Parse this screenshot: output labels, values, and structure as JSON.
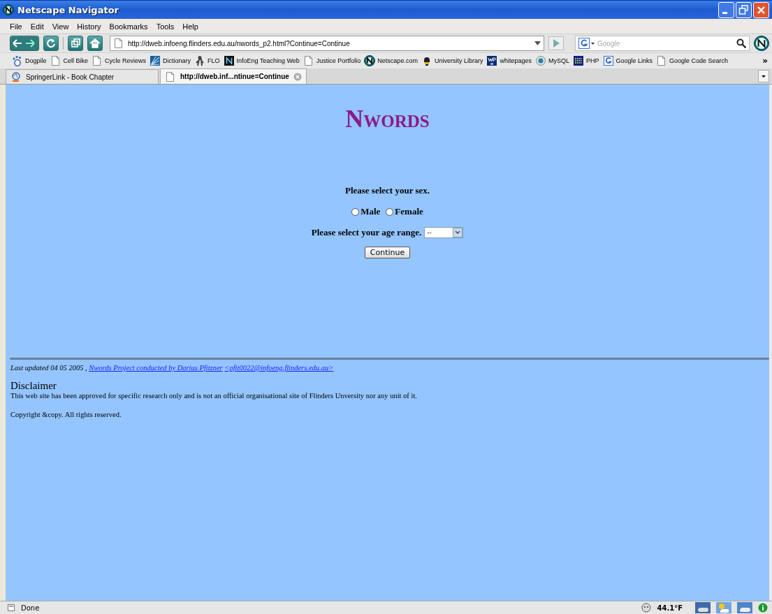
{
  "window": {
    "title": "Netscape Navigator"
  },
  "menu": [
    "File",
    "Edit",
    "View",
    "History",
    "Bookmarks",
    "Tools",
    "Help"
  ],
  "address": {
    "value": "http://dweb.infoeng.flinders.edu.au/nwords_p2.html?Continue=Continue"
  },
  "search": {
    "placeholder": "Google"
  },
  "bookmarks": [
    {
      "label": "Dogpile"
    },
    {
      "label": "Cell Bike"
    },
    {
      "label": "Cycle Reviews"
    },
    {
      "label": "Dictionary"
    },
    {
      "label": "FLO"
    },
    {
      "label": "InfoEng Teaching Web"
    },
    {
      "label": "Justice Portfolio"
    },
    {
      "label": "Netscape.com"
    },
    {
      "label": "University Library"
    },
    {
      "label": "whitepages"
    },
    {
      "label": "MySQL"
    },
    {
      "label": "PHP"
    },
    {
      "label": "Google Links"
    },
    {
      "label": "Google Code Search"
    }
  ],
  "bookmarks_more": "»",
  "tabs": [
    {
      "label": "SpringerLink - Book Chapter",
      "selected": false
    },
    {
      "label": "http://dweb.inf...ntinue=Continue",
      "selected": true
    }
  ],
  "page": {
    "heading": "Nwords",
    "sex_prompt": "Please select your sex.",
    "sex_options": [
      {
        "label": "Male",
        "selected": false
      },
      {
        "label": "Female",
        "selected": false
      }
    ],
    "age_prompt": "Please select your age range.",
    "age_select": {
      "value": "--"
    },
    "button": "Continue",
    "updated": "Last updated 04 05 2005 ,",
    "project_link": "Nwords Project conducted by Darius Pfitzner",
    "email_link": "<pfit0022@infoeng.flinders.edu.au>",
    "disclaimer_title": "Disclaimer",
    "disclaimer_text": "This web site has been approved for specific research only and is not an official organisational site of Flinders Unversity nor any unit of it.",
    "copyright": "Copyright &copy. All rights reserved."
  },
  "status": {
    "text": "Done",
    "temperature": "44.1°F"
  }
}
